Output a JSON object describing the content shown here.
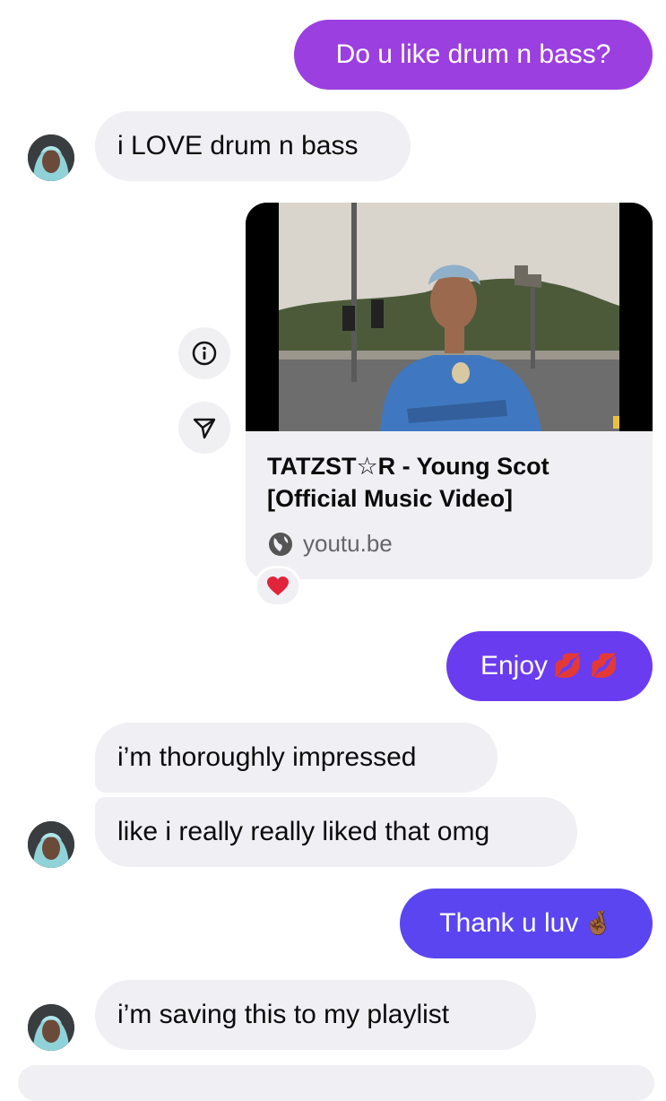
{
  "colors": {
    "outgoing_purple": "#9b3fe0",
    "outgoing_violet": "#6a3cf0",
    "outgoing_blue": "#5a45f0",
    "incoming_bg": "#efeff4",
    "heart": "#e0243c"
  },
  "messages": [
    {
      "id": "m1",
      "from": "me",
      "text": "Do u like drum n bass?"
    },
    {
      "id": "m2",
      "from": "them",
      "text": "i LOVE drum n bass"
    },
    {
      "id": "m3",
      "from": "them",
      "type": "link_card",
      "title": "TATZST☆R - Young Scot [Official Music Video]",
      "domain": "youtu.be",
      "reaction": "heart",
      "icons": [
        "info-icon",
        "share-send-icon",
        "globe-icon"
      ]
    },
    {
      "id": "m4",
      "from": "me",
      "text": "Enjoy",
      "emoji": "💋 💋"
    },
    {
      "id": "m5",
      "from": "them",
      "text": "i’m thoroughly impressed"
    },
    {
      "id": "m6",
      "from": "them",
      "text": "like i really really liked that omg"
    },
    {
      "id": "m7",
      "from": "me",
      "text": "Thank u luv",
      "emoji": "🤞🏾"
    },
    {
      "id": "m8",
      "from": "them",
      "text": "i’m saving this to my playlist"
    }
  ]
}
